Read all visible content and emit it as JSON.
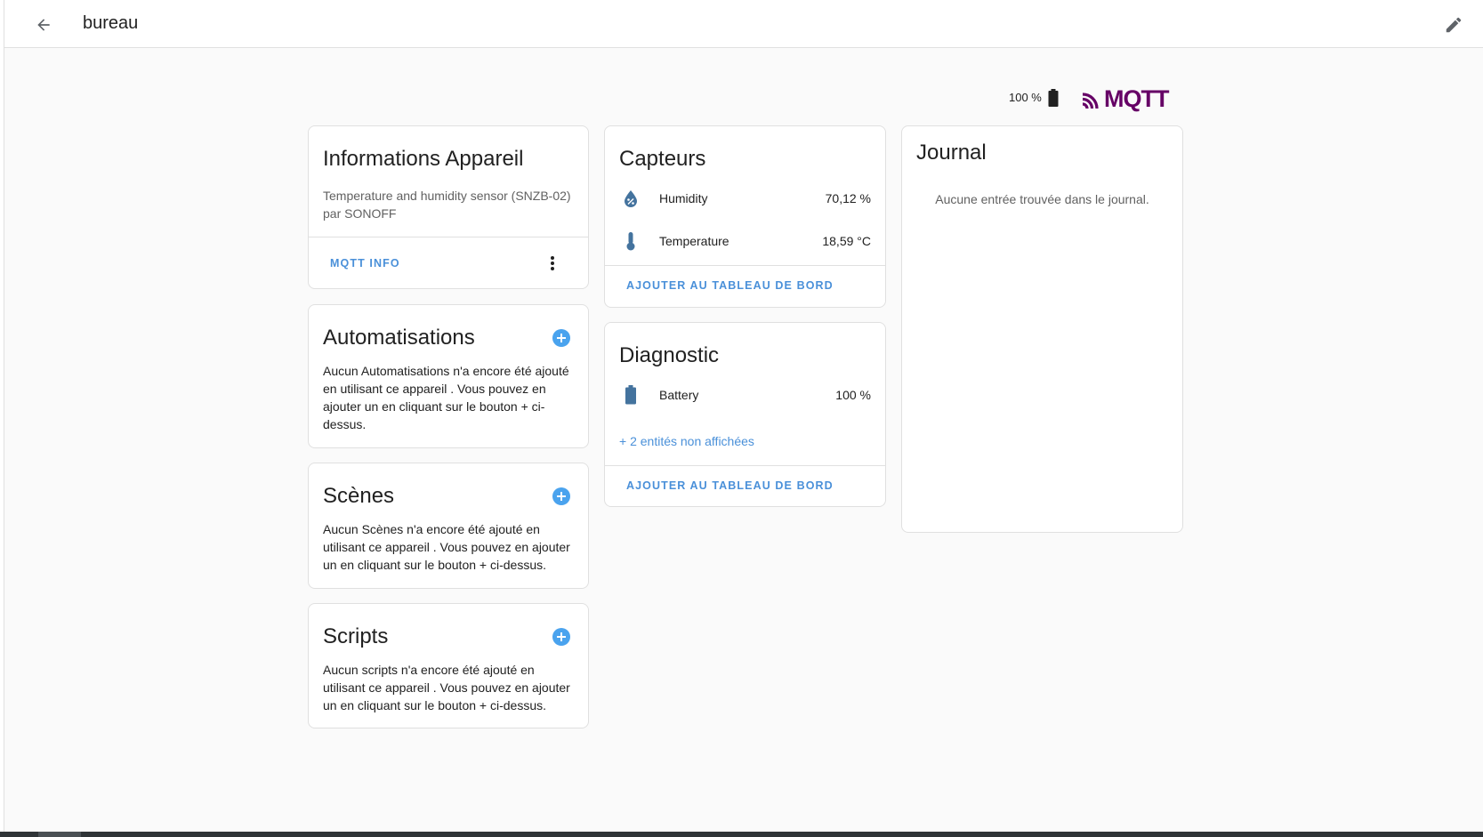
{
  "topbar": {
    "title": "bureau",
    "back_icon": "arrow-left-icon",
    "edit_icon": "pencil-icon"
  },
  "header": {
    "battery_text": "100 %",
    "logo_text": "MQTT",
    "logo_color": "#660066"
  },
  "device_info": {
    "title": "Informations Appareil",
    "model": "Temperature and humidity sensor (SNZB-02)",
    "manufacturer": "par SONOFF",
    "mqtt_button": "MQTT INFO"
  },
  "automations": {
    "title": "Automatisations",
    "text": "Aucun Automatisations n'a encore été ajouté en utilisant ce appareil . Vous pouvez en ajouter un en cliquant sur le bouton + ci-dessus."
  },
  "scenes": {
    "title": "Scènes",
    "text": "Aucun Scènes n'a encore été ajouté en utilisant ce appareil . Vous pouvez en ajouter un en cliquant sur le bouton + ci-dessus."
  },
  "scripts": {
    "title": "Scripts",
    "text": "Aucun scripts n'a encore été ajouté en utilisant ce appareil . Vous pouvez en ajouter un en cliquant sur le bouton + ci-dessus."
  },
  "sensors": {
    "title": "Capteurs",
    "rows": [
      {
        "name": "Humidity",
        "value": "70,12 %",
        "icon": "water-percent-icon"
      },
      {
        "name": "Temperature",
        "value": "18,59 °C",
        "icon": "thermometer-icon"
      }
    ],
    "add_button": "AJOUTER AU TABLEAU DE BORD"
  },
  "diagnostic": {
    "title": "Diagnostic",
    "rows": [
      {
        "name": "Battery",
        "value": "100 %",
        "icon": "battery-icon"
      }
    ],
    "hidden_link": "+ 2 entités non affichées",
    "add_button": "AJOUTER AU TABLEAU DE BORD"
  },
  "journal": {
    "title": "Journal",
    "empty_text": "Aucune entrée trouvée dans le journal."
  },
  "colors": {
    "accent": "#4a90d9",
    "icon": "#44739e",
    "background": "#fafafa"
  }
}
